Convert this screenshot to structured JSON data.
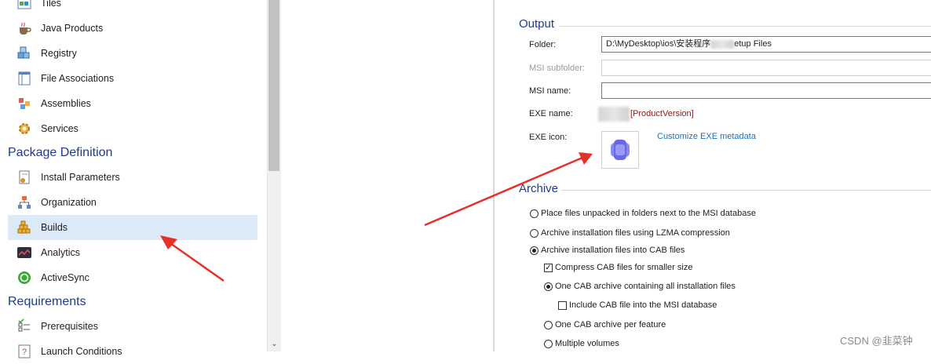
{
  "sidebar": {
    "items_top": [
      {
        "label": "Tiles",
        "icon": "tiles-icon"
      },
      {
        "label": "Java Products",
        "icon": "java-cup-icon"
      },
      {
        "label": "Registry",
        "icon": "registry-icon"
      },
      {
        "label": "File Associations",
        "icon": "file-associations-icon"
      },
      {
        "label": "Assemblies",
        "icon": "assemblies-icon"
      },
      {
        "label": "Services",
        "icon": "services-gear-icon"
      }
    ],
    "package_definition_title": "Package Definition",
    "items_package": [
      {
        "label": "Install Parameters",
        "icon": "install-parameters-icon"
      },
      {
        "label": "Organization",
        "icon": "organization-icon"
      },
      {
        "label": "Builds",
        "icon": "builds-icon",
        "selected": true
      },
      {
        "label": "Analytics",
        "icon": "analytics-icon"
      },
      {
        "label": "ActiveSync",
        "icon": "activesync-icon"
      }
    ],
    "requirements_title": "Requirements",
    "items_requirements": [
      {
        "label": "Prerequisites",
        "icon": "prerequisites-icon"
      },
      {
        "label": "Launch Conditions",
        "icon": "launch-conditions-icon"
      }
    ],
    "selected_bg": "#dce9f7"
  },
  "output": {
    "title": "Output",
    "folder_label": "Folder:",
    "folder_value_start": "D:\\MyDesktop\\ios\\安装程序",
    "folder_value_end": "etup Files",
    "msi_subfolder_label": "MSI subfolder:",
    "msi_name_label": "MSI name:",
    "exe_name_label": "EXE name:",
    "exe_name_value": "[ProductVersion]",
    "exe_icon_label": "EXE icon:",
    "customize_link": "Customize EXE metadata"
  },
  "archive": {
    "title": "Archive",
    "opt_unpacked": "Place files unpacked in folders next to the MSI database",
    "opt_lzma": "Archive installation files using LZMA compression",
    "opt_cab": "Archive installation files into CAB files",
    "compress_cab": "Compress CAB files for smaller size",
    "one_cab": "One CAB archive containing all installation files",
    "include_cab": "Include CAB file into the MSI database",
    "cab_per_feature": "One CAB archive per feature",
    "multiple_volumes": "Multiple volumes",
    "selected_option": "opt_cab",
    "compress_checked": true,
    "cab_mode": "one_cab",
    "include_checked": false
  },
  "watermark": "CSDN @韭菜钟",
  "colors": {
    "section_title": "#1f3a8f",
    "link": "#1f6fb2",
    "annotation_arrow": "#e8302a"
  }
}
